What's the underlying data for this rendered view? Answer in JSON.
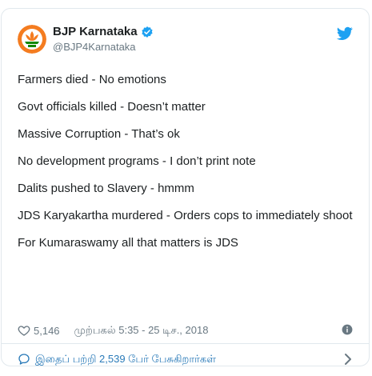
{
  "account": {
    "name": "BJP Karnataka",
    "handle": "@BJP4Karnataka"
  },
  "tweet": {
    "lines": [
      "Farmers died - No emotions",
      "Govt officials killed - Doesn’t matter",
      "Massive Corruption - That’s ok",
      "No development programs - I don’t print note",
      "Dalits pushed to Slavery - hmmm",
      "JDS Karyakartha murdered - Orders cops to immediately shoot",
      "For Kumaraswamy all that matters is JDS"
    ]
  },
  "meta": {
    "likes": "5,146",
    "timestamp": "முற்பகல் 5:35 - 25 டிச., 2018"
  },
  "footer": {
    "conversation_text": "இதைப் பற்றி 2,539 பேர் பேசுகிறார்கள்"
  },
  "colors": {
    "brand_blue": "#1da1f2",
    "link_blue": "#2b7bb9",
    "bjp_orange": "#f47c20",
    "bjp_green": "#138808"
  },
  "icons": {
    "avatar": "bjp-lotus-logo",
    "verified": "verified-badge-icon",
    "platform": "twitter-bird-icon",
    "like": "heart-icon",
    "info": "info-icon",
    "conversation": "speech-bubble-icon",
    "more": "chevron-right-icon"
  }
}
